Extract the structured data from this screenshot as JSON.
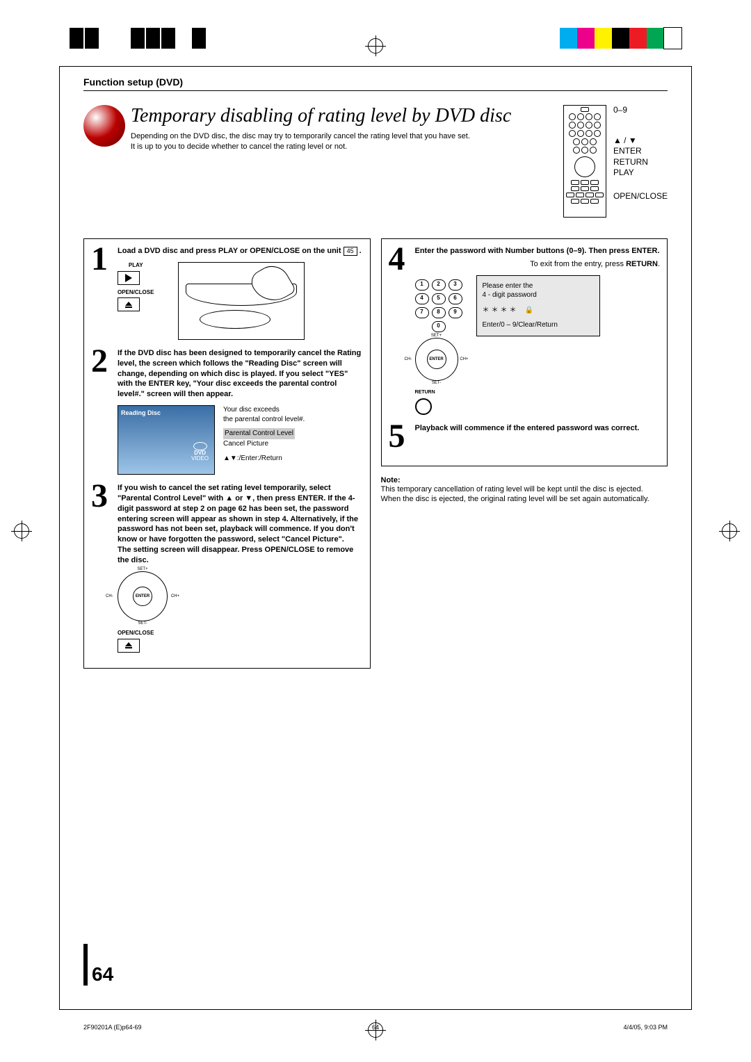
{
  "header": {
    "section": "Function setup (DVD)"
  },
  "title": "Temporary disabling of rating level by DVD disc",
  "intro": {
    "line1": "Depending on the DVD disc, the disc may try to temporarily cancel the rating level that you have set.",
    "line2": "It is up to you to decide whether to cancel the rating level or not."
  },
  "remote_labels": {
    "numbers": "0–9",
    "arrows": "▲ / ▼",
    "enter": "ENTER",
    "return": "RETURN",
    "play": "PLAY",
    "openclose": "OPEN/CLOSE"
  },
  "steps": {
    "1": {
      "text": "Load a DVD disc and press PLAY or OPEN/CLOSE on the unit ",
      "ref": "45",
      "play_label": "PLAY",
      "openclose_label": "OPEN/CLOSE"
    },
    "2": {
      "text": "If the DVD disc has been designed to temporarily cancel the Rating level, the screen which follows the \"Reading Disc\" screen will change, depending on which disc is played. If you select \"YES\" with the ENTER key, \"Your disc exceeds the parental control level#.\" screen will then appear.",
      "reading_disc_label": "Reading Disc",
      "dvd_logo_top": "DVD",
      "dvd_logo_bottom": "VIDEO",
      "exceeds_line1": "Your disc exceeds",
      "exceeds_line2": "the parental control level#.",
      "opt1": "Parental Control Level",
      "opt2": "Cancel Picture",
      "hint": "▲▼:/Enter:/Return"
    },
    "3": {
      "text": "If you wish to cancel the set rating level temporarily, select \"Parental Control Level\" with ▲ or ▼, then press ENTER. If the 4-digit password at step 2 on page 62 has been set, the password entering screen will appear as shown in step 4. Alternatively, if the password has not been set, playback will commence. If you don't know or have forgotten the password, select \"Cancel Picture\".",
      "text2": "The setting screen will disappear. Press OPEN/CLOSE to remove the disc.",
      "set_plus": "SET+",
      "set_minus": "SET-",
      "ch_minus": "CH-",
      "ch_plus": "CH+",
      "enter": "ENTER",
      "openclose_label": "OPEN/CLOSE"
    },
    "4": {
      "text": "Enter the password with Number buttons (0–9). Then press ENTER.",
      "exit_text_a": "To exit from the entry, press ",
      "exit_text_b": "RETURN",
      "exit_text_c": ".",
      "pw_line1": "Please enter the",
      "pw_line2": "4 - digit password",
      "pw_stars": "＊＊＊＊",
      "pw_hint": "Enter/0 – 9/Clear/Return",
      "set_plus": "SET+",
      "set_minus": "SET-",
      "ch_minus": "CH-",
      "ch_plus": "CH+",
      "enter": "ENTER",
      "return_label": "RETURN"
    },
    "5": {
      "text": "Playback will commence if the entered password was correct."
    }
  },
  "note": {
    "title": "Note:",
    "line1": "This temporary cancellation of rating level will be kept until the disc is ejected.",
    "line2": "When the disc is ejected, the original rating level will be set again automatically."
  },
  "page_number": "64",
  "footer": {
    "left": "2F90201A (E)p64-69",
    "mid": "64",
    "right": "4/4/05, 9:03 PM"
  },
  "colorbar": [
    "#00aeef",
    "#ec008c",
    "#fff200",
    "#000000",
    "#ed1c24",
    "#00a651",
    "#ffffff"
  ]
}
